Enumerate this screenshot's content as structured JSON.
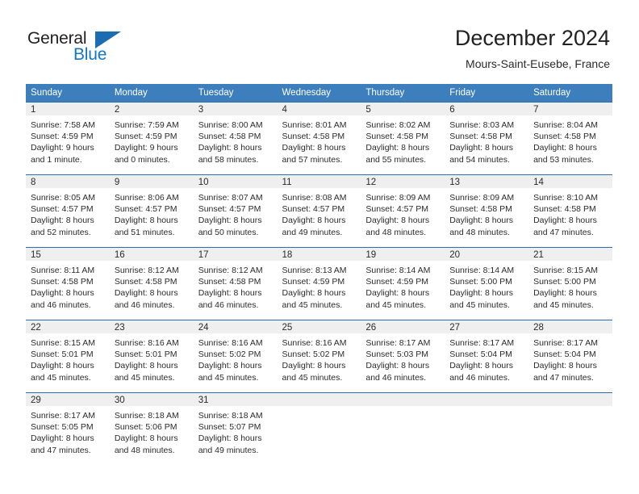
{
  "brand": {
    "name_primary": "General",
    "name_secondary": "Blue",
    "triangle_color": "#1b6cb0",
    "primary_color": "#231f20",
    "secondary_color": "#1277c4"
  },
  "header": {
    "title": "December 2024",
    "location": "Mours-Saint-Eusebe, France"
  },
  "theme": {
    "header_row_bg": "#3d7ebd",
    "header_row_text": "#ffffff",
    "day_band_bg": "#efefef",
    "row_divider": "#2a6db0",
    "body_text": "#2b2b2b"
  },
  "calendar": {
    "weekday_headers": [
      "Sunday",
      "Monday",
      "Tuesday",
      "Wednesday",
      "Thursday",
      "Friday",
      "Saturday"
    ],
    "weeks": [
      [
        {
          "day": "1",
          "sunrise": "Sunrise: 7:58 AM",
          "sunset": "Sunset: 4:59 PM",
          "daylight_line1": "Daylight: 9 hours",
          "daylight_line2": "and 1 minute."
        },
        {
          "day": "2",
          "sunrise": "Sunrise: 7:59 AM",
          "sunset": "Sunset: 4:59 PM",
          "daylight_line1": "Daylight: 9 hours",
          "daylight_line2": "and 0 minutes."
        },
        {
          "day": "3",
          "sunrise": "Sunrise: 8:00 AM",
          "sunset": "Sunset: 4:58 PM",
          "daylight_line1": "Daylight: 8 hours",
          "daylight_line2": "and 58 minutes."
        },
        {
          "day": "4",
          "sunrise": "Sunrise: 8:01 AM",
          "sunset": "Sunset: 4:58 PM",
          "daylight_line1": "Daylight: 8 hours",
          "daylight_line2": "and 57 minutes."
        },
        {
          "day": "5",
          "sunrise": "Sunrise: 8:02 AM",
          "sunset": "Sunset: 4:58 PM",
          "daylight_line1": "Daylight: 8 hours",
          "daylight_line2": "and 55 minutes."
        },
        {
          "day": "6",
          "sunrise": "Sunrise: 8:03 AM",
          "sunset": "Sunset: 4:58 PM",
          "daylight_line1": "Daylight: 8 hours",
          "daylight_line2": "and 54 minutes."
        },
        {
          "day": "7",
          "sunrise": "Sunrise: 8:04 AM",
          "sunset": "Sunset: 4:58 PM",
          "daylight_line1": "Daylight: 8 hours",
          "daylight_line2": "and 53 minutes."
        }
      ],
      [
        {
          "day": "8",
          "sunrise": "Sunrise: 8:05 AM",
          "sunset": "Sunset: 4:57 PM",
          "daylight_line1": "Daylight: 8 hours",
          "daylight_line2": "and 52 minutes."
        },
        {
          "day": "9",
          "sunrise": "Sunrise: 8:06 AM",
          "sunset": "Sunset: 4:57 PM",
          "daylight_line1": "Daylight: 8 hours",
          "daylight_line2": "and 51 minutes."
        },
        {
          "day": "10",
          "sunrise": "Sunrise: 8:07 AM",
          "sunset": "Sunset: 4:57 PM",
          "daylight_line1": "Daylight: 8 hours",
          "daylight_line2": "and 50 minutes."
        },
        {
          "day": "11",
          "sunrise": "Sunrise: 8:08 AM",
          "sunset": "Sunset: 4:57 PM",
          "daylight_line1": "Daylight: 8 hours",
          "daylight_line2": "and 49 minutes."
        },
        {
          "day": "12",
          "sunrise": "Sunrise: 8:09 AM",
          "sunset": "Sunset: 4:57 PM",
          "daylight_line1": "Daylight: 8 hours",
          "daylight_line2": "and 48 minutes."
        },
        {
          "day": "13",
          "sunrise": "Sunrise: 8:09 AM",
          "sunset": "Sunset: 4:58 PM",
          "daylight_line1": "Daylight: 8 hours",
          "daylight_line2": "and 48 minutes."
        },
        {
          "day": "14",
          "sunrise": "Sunrise: 8:10 AM",
          "sunset": "Sunset: 4:58 PM",
          "daylight_line1": "Daylight: 8 hours",
          "daylight_line2": "and 47 minutes."
        }
      ],
      [
        {
          "day": "15",
          "sunrise": "Sunrise: 8:11 AM",
          "sunset": "Sunset: 4:58 PM",
          "daylight_line1": "Daylight: 8 hours",
          "daylight_line2": "and 46 minutes."
        },
        {
          "day": "16",
          "sunrise": "Sunrise: 8:12 AM",
          "sunset": "Sunset: 4:58 PM",
          "daylight_line1": "Daylight: 8 hours",
          "daylight_line2": "and 46 minutes."
        },
        {
          "day": "17",
          "sunrise": "Sunrise: 8:12 AM",
          "sunset": "Sunset: 4:58 PM",
          "daylight_line1": "Daylight: 8 hours",
          "daylight_line2": "and 46 minutes."
        },
        {
          "day": "18",
          "sunrise": "Sunrise: 8:13 AM",
          "sunset": "Sunset: 4:59 PM",
          "daylight_line1": "Daylight: 8 hours",
          "daylight_line2": "and 45 minutes."
        },
        {
          "day": "19",
          "sunrise": "Sunrise: 8:14 AM",
          "sunset": "Sunset: 4:59 PM",
          "daylight_line1": "Daylight: 8 hours",
          "daylight_line2": "and 45 minutes."
        },
        {
          "day": "20",
          "sunrise": "Sunrise: 8:14 AM",
          "sunset": "Sunset: 5:00 PM",
          "daylight_line1": "Daylight: 8 hours",
          "daylight_line2": "and 45 minutes."
        },
        {
          "day": "21",
          "sunrise": "Sunrise: 8:15 AM",
          "sunset": "Sunset: 5:00 PM",
          "daylight_line1": "Daylight: 8 hours",
          "daylight_line2": "and 45 minutes."
        }
      ],
      [
        {
          "day": "22",
          "sunrise": "Sunrise: 8:15 AM",
          "sunset": "Sunset: 5:01 PM",
          "daylight_line1": "Daylight: 8 hours",
          "daylight_line2": "and 45 minutes."
        },
        {
          "day": "23",
          "sunrise": "Sunrise: 8:16 AM",
          "sunset": "Sunset: 5:01 PM",
          "daylight_line1": "Daylight: 8 hours",
          "daylight_line2": "and 45 minutes."
        },
        {
          "day": "24",
          "sunrise": "Sunrise: 8:16 AM",
          "sunset": "Sunset: 5:02 PM",
          "daylight_line1": "Daylight: 8 hours",
          "daylight_line2": "and 45 minutes."
        },
        {
          "day": "25",
          "sunrise": "Sunrise: 8:16 AM",
          "sunset": "Sunset: 5:02 PM",
          "daylight_line1": "Daylight: 8 hours",
          "daylight_line2": "and 45 minutes."
        },
        {
          "day": "26",
          "sunrise": "Sunrise: 8:17 AM",
          "sunset": "Sunset: 5:03 PM",
          "daylight_line1": "Daylight: 8 hours",
          "daylight_line2": "and 46 minutes."
        },
        {
          "day": "27",
          "sunrise": "Sunrise: 8:17 AM",
          "sunset": "Sunset: 5:04 PM",
          "daylight_line1": "Daylight: 8 hours",
          "daylight_line2": "and 46 minutes."
        },
        {
          "day": "28",
          "sunrise": "Sunrise: 8:17 AM",
          "sunset": "Sunset: 5:04 PM",
          "daylight_line1": "Daylight: 8 hours",
          "daylight_line2": "and 47 minutes."
        }
      ],
      [
        {
          "day": "29",
          "sunrise": "Sunrise: 8:17 AM",
          "sunset": "Sunset: 5:05 PM",
          "daylight_line1": "Daylight: 8 hours",
          "daylight_line2": "and 47 minutes."
        },
        {
          "day": "30",
          "sunrise": "Sunrise: 8:18 AM",
          "sunset": "Sunset: 5:06 PM",
          "daylight_line1": "Daylight: 8 hours",
          "daylight_line2": "and 48 minutes."
        },
        {
          "day": "31",
          "sunrise": "Sunrise: 8:18 AM",
          "sunset": "Sunset: 5:07 PM",
          "daylight_line1": "Daylight: 8 hours",
          "daylight_line2": "and 49 minutes."
        },
        {
          "day": "",
          "sunrise": "",
          "sunset": "",
          "daylight_line1": "",
          "daylight_line2": ""
        },
        {
          "day": "",
          "sunrise": "",
          "sunset": "",
          "daylight_line1": "",
          "daylight_line2": ""
        },
        {
          "day": "",
          "sunrise": "",
          "sunset": "",
          "daylight_line1": "",
          "daylight_line2": ""
        },
        {
          "day": "",
          "sunrise": "",
          "sunset": "",
          "daylight_line1": "",
          "daylight_line2": ""
        }
      ]
    ]
  }
}
